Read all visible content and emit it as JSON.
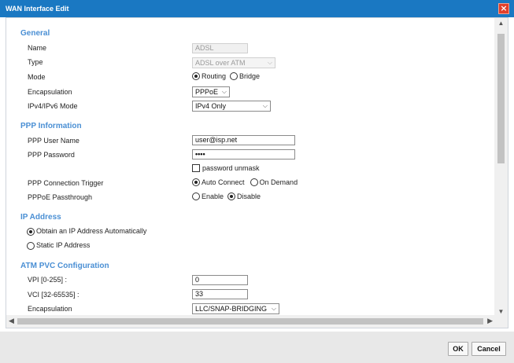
{
  "window": {
    "title": "WAN Interface Edit"
  },
  "general": {
    "heading": "General",
    "name": {
      "label": "Name",
      "value": "ADSL"
    },
    "type": {
      "label": "Type",
      "value": "ADSL over ATM"
    },
    "mode": {
      "label": "Mode",
      "options": [
        "Routing",
        "Bridge"
      ],
      "selected": "Routing"
    },
    "encapsulation": {
      "label": "Encapsulation",
      "value": "PPPoE"
    },
    "ip_mode": {
      "label": "IPv4/IPv6 Mode",
      "value": "IPv4 Only"
    }
  },
  "ppp": {
    "heading": "PPP Information",
    "user_name": {
      "label": "PPP User Name",
      "value": "user@isp.net"
    },
    "password": {
      "label": "PPP Password",
      "value": "••••"
    },
    "unmask": {
      "label": "password unmask",
      "checked": false
    },
    "trigger": {
      "label": "PPP Connection Trigger",
      "options": [
        "Auto Connect",
        "On Demand"
      ],
      "selected": "Auto Connect"
    },
    "passthrough": {
      "label": "PPPoE Passthrough",
      "options": [
        "Enable",
        "Disable"
      ],
      "selected": "Disable"
    }
  },
  "ip_address": {
    "heading": "IP Address",
    "options": [
      "Obtain an IP Address Automatically",
      "Static IP Address"
    ],
    "selected": "Obtain an IP Address Automatically"
  },
  "atm_pvc": {
    "heading": "ATM PVC Configuration",
    "vpi": {
      "label": "VPI [0-255] :",
      "value": "0"
    },
    "vci": {
      "label": "VCI [32-65535] :",
      "value": "33"
    },
    "encapsulation": {
      "label": "Encapsulation",
      "value": "LLC/SNAP-BRIDGING"
    }
  },
  "buttons": {
    "ok": "OK",
    "cancel": "Cancel"
  }
}
